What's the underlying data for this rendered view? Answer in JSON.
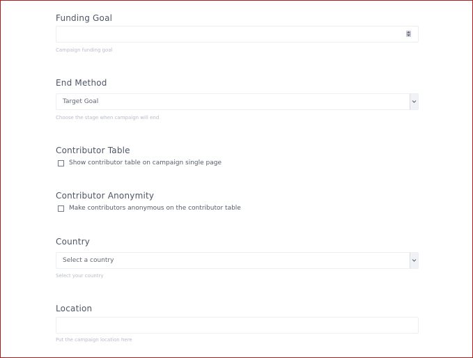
{
  "funding_goal": {
    "label": "Funding Goal",
    "value": "",
    "help": "Campaign funding goal"
  },
  "end_method": {
    "label": "End Method",
    "selected": "Target Goal",
    "help": "Choose the stage when campaign will end"
  },
  "contributor_table": {
    "label": "Contributor Table",
    "checkbox_label": "Show contributor table on campaign single page",
    "checked": false
  },
  "contributor_anonymity": {
    "label": "Contributor Anonymity",
    "checkbox_label": "Make contributors anonymous on the contributor table",
    "checked": false
  },
  "country": {
    "label": "Country",
    "selected": "Select a country",
    "help": "Select your country"
  },
  "location": {
    "label": "Location",
    "value": "",
    "help": "Put the campaign location here"
  },
  "colors": {
    "frame_border": "#b01c1c",
    "label_text": "#4d5566",
    "help_text": "#b8bdc7"
  }
}
